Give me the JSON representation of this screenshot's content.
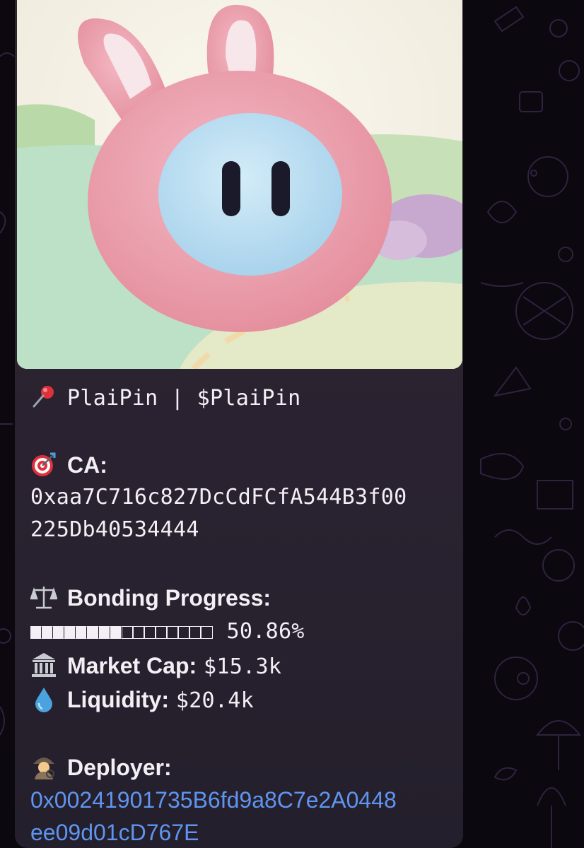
{
  "message": {
    "image_alt": "pink bunny-eared plush toy with blue face",
    "title_line": "PlaiPin | $PlaiPin",
    "ca_label": "CA:",
    "ca_line1": "0xaa7C716c827DcCdFCfA544B3f00",
    "ca_line2": "225Db40534444",
    "bonding_label": "Bonding Progress:",
    "bonding_percent_text": "50.86%",
    "bonding_progress": 0.5086,
    "bonding_blocks_total": 16,
    "bonding_blocks_filled": 8,
    "market_cap_label": "Market Cap:",
    "market_cap_value": "$15.3k",
    "liquidity_label": "Liquidity:",
    "liquidity_value": "$20.4k",
    "deployer_label": "Deployer:",
    "deployer_line1": "0x00241901735B6fd9a8C7e2A0448",
    "deployer_line2": "ee09d01cD767E"
  },
  "icons": {
    "title": "pushpin-icon",
    "ca": "direct-hit-icon",
    "bonding": "balance-scale-icon",
    "market_cap": "classical-building-icon",
    "liquidity": "droplet-icon",
    "deployer": "detective-icon"
  },
  "colors": {
    "wallpaper": "#0b080f",
    "bubble": "#2a2230",
    "text": "#f3f0f5",
    "link": "#5f95f0"
  }
}
